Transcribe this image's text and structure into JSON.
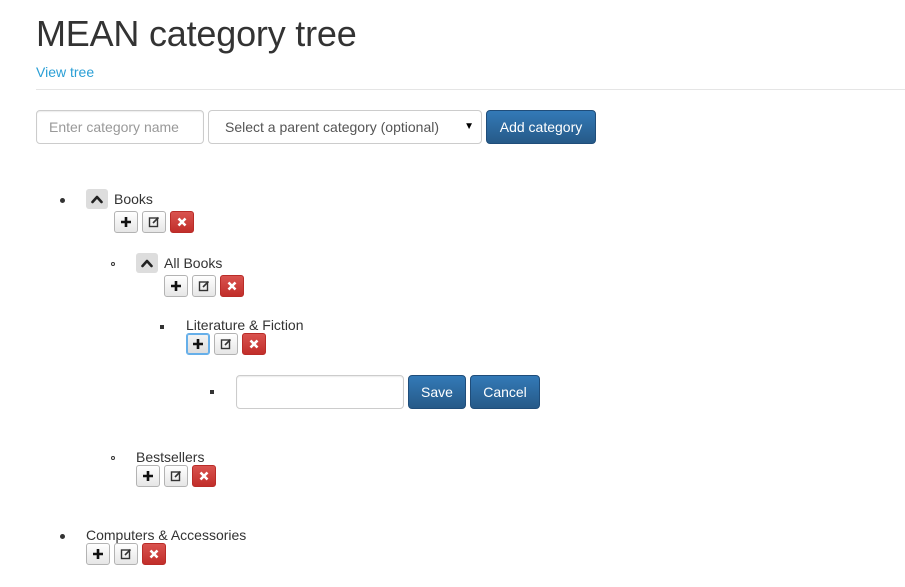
{
  "header": {
    "title": "MEAN category tree",
    "view_tree_link": "View tree"
  },
  "form": {
    "name_placeholder": "Enter category name",
    "parent_select_value": "Select a parent category (optional)",
    "add_button": "Add category"
  },
  "tree": {
    "books": "Books",
    "all_books": "All Books",
    "literature": "Literature & Fiction",
    "bestsellers": "Bestsellers",
    "computers": "Computers & Accessories"
  },
  "inline_form": {
    "input_value": "",
    "save_button": "Save",
    "cancel_button": "Cancel"
  },
  "colors": {
    "primary": "#2f6ea6",
    "danger": "#d43f3a",
    "link": "#2a9fd6"
  },
  "icons": {
    "toggle": "chevron-up-icon",
    "add": "plus-icon",
    "edit": "edit-icon",
    "remove": "remove-icon"
  }
}
